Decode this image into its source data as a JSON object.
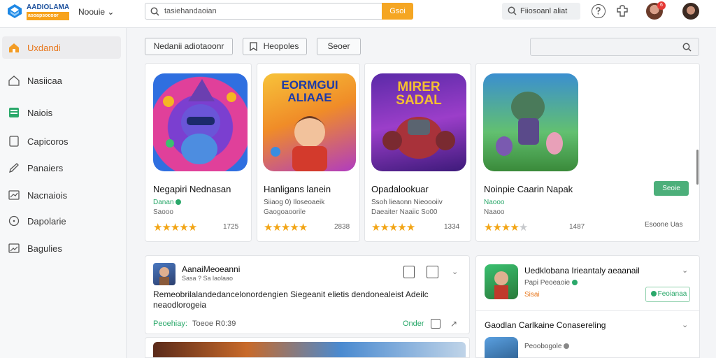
{
  "header": {
    "brand_line1": "AADIOLAMA",
    "brand_line2": "asoapsocoor",
    "home_menu": "Noouie ⌄",
    "search_placeholder": "tasiehandaoian",
    "search_button": "Gsoi",
    "explore_label": "Fiiosoanl aliat",
    "notification_count": "6",
    "icons": [
      "app-logo-icon",
      "search-icon",
      "help-icon",
      "puzzle-icon"
    ]
  },
  "sidebar": {
    "items": [
      {
        "label": "Uxdandi",
        "icon": "home-orange-icon",
        "active": true
      },
      {
        "label": "Nasiicaa",
        "icon": "house-outline-icon",
        "active": false
      },
      {
        "label": "Naiois",
        "icon": "grid-green-icon",
        "active": false
      },
      {
        "label": "Capicoros",
        "icon": "square-outline-icon",
        "active": false
      },
      {
        "label": "Panaiers",
        "icon": "pen-icon",
        "active": false
      },
      {
        "label": "Nacnaiois",
        "icon": "chart-box-icon",
        "active": false
      },
      {
        "label": "Dapolarie",
        "icon": "compass-icon",
        "active": false
      },
      {
        "label": "Bagulies",
        "icon": "image-box-icon",
        "active": false
      }
    ]
  },
  "filters": {
    "chips": [
      "Nedanii adiotaoonr",
      "Heopoles",
      "Seoer"
    ],
    "search_placeholder": ""
  },
  "games": [
    {
      "title": "Negapiri Nednasan",
      "developer": "Danan",
      "subtitle": "Saooo",
      "rating": 4.5,
      "count": "1725",
      "art_text": ""
    },
    {
      "title": "Hanligans lanein",
      "developer": "Siiaog 0) Iloseoaeik",
      "subtitle": "Gaogoaoorile",
      "rating": 4.5,
      "count": "2838",
      "art_text": "EORMGUI ALIAAE"
    },
    {
      "title": "Opadalookuar",
      "developer": "Ssoh lieaonn Nieoooiiv",
      "subtitle": "Daeaiter Naaiic So00",
      "rating": 4.5,
      "count": "1334",
      "art_text": "MIRER SADAL"
    },
    {
      "title": "Noinpie Caarin Napak",
      "developer": "Naooo",
      "subtitle": "Naaoo",
      "rating": 3.5,
      "count": "1487",
      "get_label": "Seoie",
      "more_label": "Esoone Uas"
    }
  ],
  "post": {
    "name": "AanaiMeoeanni",
    "meta": "Sasa ? Sa laolaao",
    "body": "Remeobrilalandedancelonordengien Siegeanit elietis dendonealeist Adeilc neaodlorogeia",
    "reply_label": "Peoehiay:",
    "timestamp": "Toeoe R0:39",
    "action_label": "Onder"
  },
  "recommendations": {
    "items": [
      {
        "title": "Uedklobana Irieantaly aeaanail",
        "subtitle": "Papi Peoeaoie",
        "subtitle2": "Sisai",
        "button": "Feoianaa"
      },
      {
        "title": "Gaodlan Carlkaine Conasereling",
        "subtitle": "Peoobogole"
      }
    ]
  }
}
